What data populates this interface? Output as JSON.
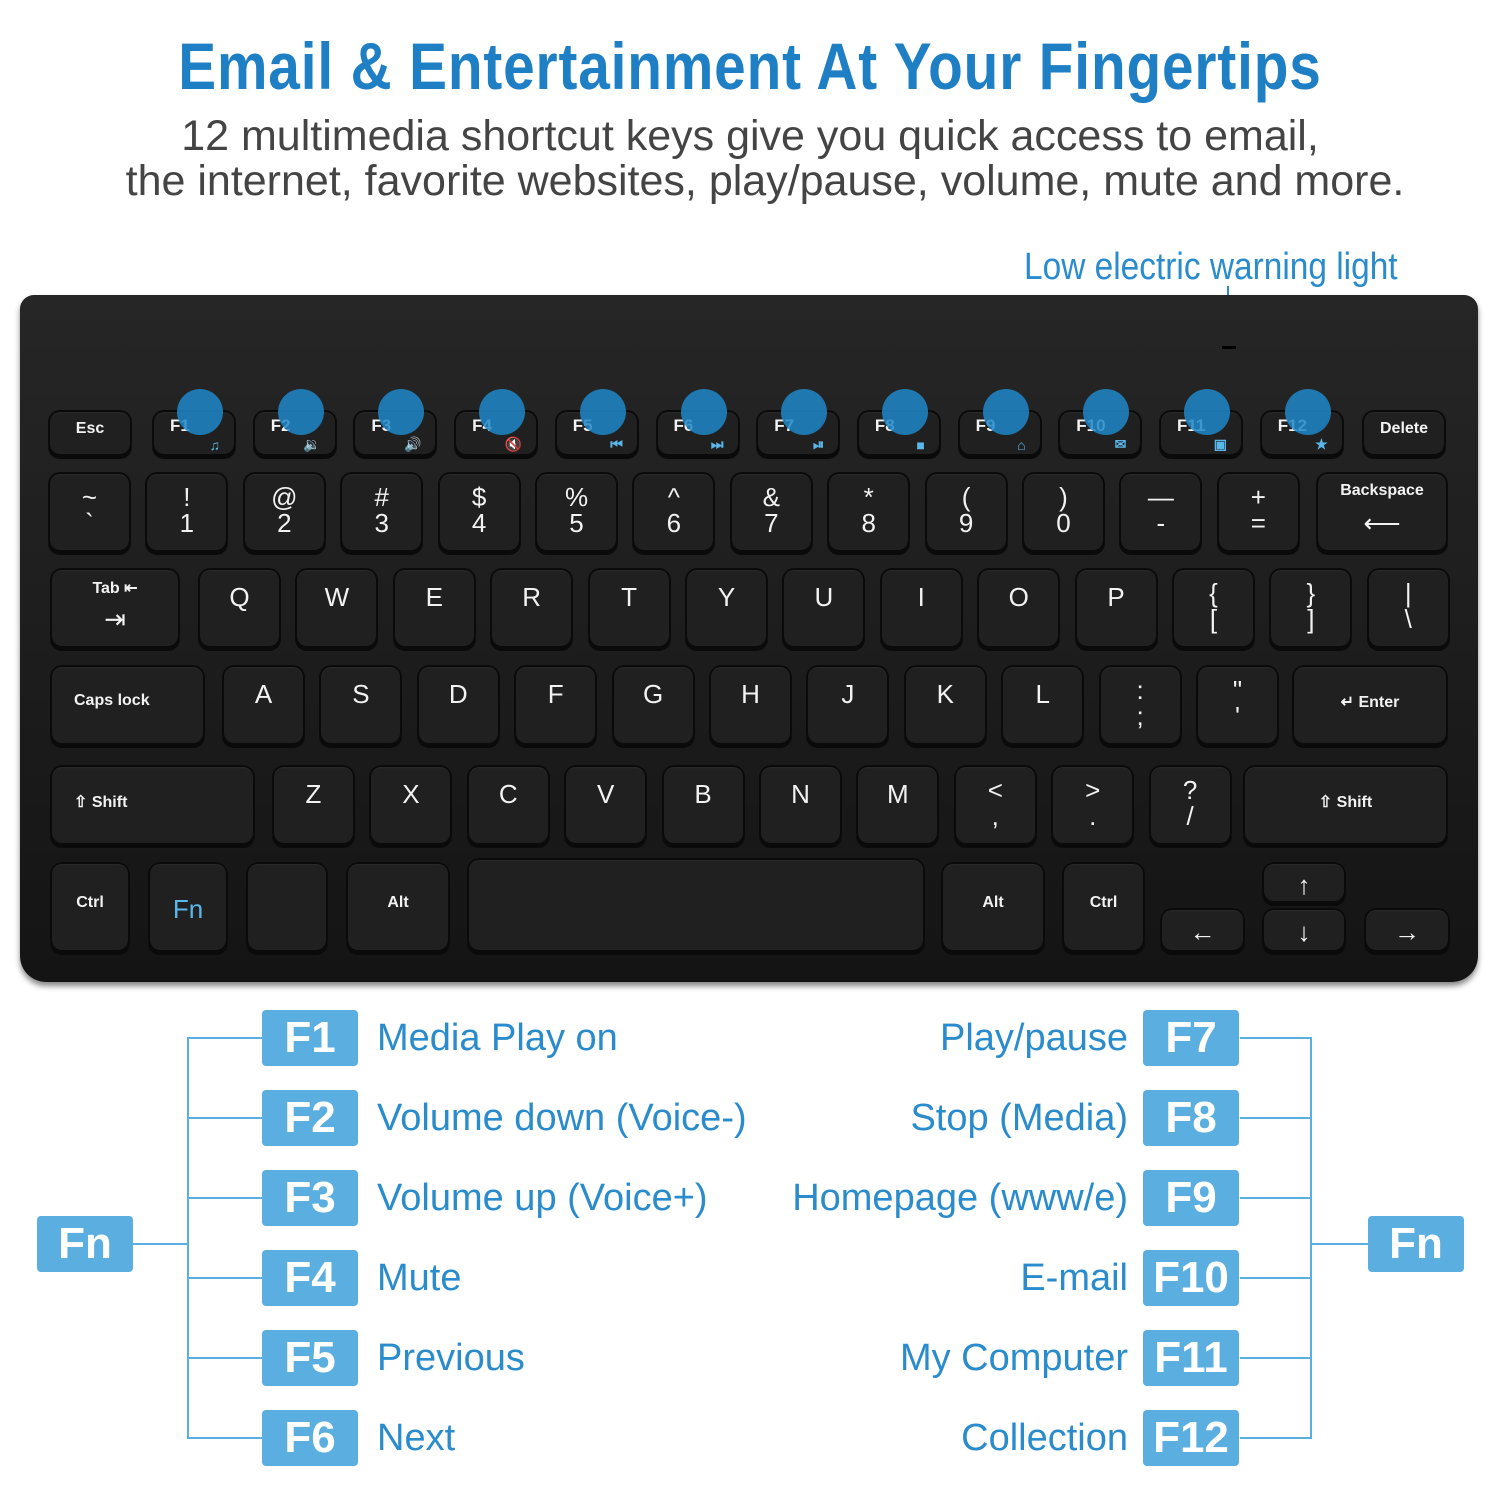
{
  "header": {
    "title": "Email & Entertainment At Your Fingertips",
    "subtitle_line1": "12 multimedia shortcut keys give you quick access to email,",
    "subtitle_line2": "the internet, favorite websites, play/pause, volume, mute and more."
  },
  "warning_light_label": "Low electric warning light",
  "accent_color": "#2a8ccc",
  "keyboard": {
    "function_row": [
      {
        "top": "Esc"
      },
      {
        "top": "F1",
        "icon": "music-note-icon",
        "glyph": "♫"
      },
      {
        "top": "F2",
        "icon": "volume-down-icon",
        "glyph": "🔉"
      },
      {
        "top": "F3",
        "icon": "volume-up-icon",
        "glyph": "🔊"
      },
      {
        "top": "F4",
        "icon": "mute-icon",
        "glyph": "🔇"
      },
      {
        "top": "F5",
        "icon": "previous-track-icon",
        "glyph": "⏮"
      },
      {
        "top": "F6",
        "icon": "next-track-icon",
        "glyph": "⏭"
      },
      {
        "top": "F7",
        "icon": "play-pause-icon",
        "glyph": "⏯"
      },
      {
        "top": "F8",
        "icon": "stop-icon",
        "glyph": "■"
      },
      {
        "top": "F9",
        "icon": "home-icon",
        "glyph": "⌂"
      },
      {
        "top": "F10",
        "icon": "mail-icon",
        "glyph": "✉"
      },
      {
        "top": "F11",
        "icon": "computer-icon",
        "glyph": "▣"
      },
      {
        "top": "F12",
        "icon": "favorites-folder-icon",
        "glyph": "★"
      },
      {
        "top": "Delete"
      }
    ],
    "number_row": [
      {
        "top": "~",
        "bottom": "`"
      },
      {
        "top": "!",
        "bottom": "1"
      },
      {
        "top": "@",
        "bottom": "2"
      },
      {
        "top": "#",
        "bottom": "3"
      },
      {
        "top": "$",
        "bottom": "4"
      },
      {
        "top": "%",
        "bottom": "5"
      },
      {
        "top": "^",
        "bottom": "6"
      },
      {
        "top": "&",
        "bottom": "7"
      },
      {
        "top": "*",
        "bottom": "8"
      },
      {
        "top": "(",
        "bottom": "9"
      },
      {
        "top": ")",
        "bottom": "0"
      },
      {
        "top": "—",
        "bottom": "-"
      },
      {
        "top": "+",
        "bottom": "="
      },
      {
        "top": "Backspace",
        "bottom": "⟵"
      }
    ],
    "qwerty_row": [
      {
        "top": "Tab ⇤",
        "bottom": "⇥"
      },
      {
        "top": "Q"
      },
      {
        "top": "W"
      },
      {
        "top": "E"
      },
      {
        "top": "R"
      },
      {
        "top": "T"
      },
      {
        "top": "Y"
      },
      {
        "top": "U"
      },
      {
        "top": "I"
      },
      {
        "top": "O"
      },
      {
        "top": "P"
      },
      {
        "top": "{",
        "bottom": "["
      },
      {
        "top": "}",
        "bottom": "]"
      },
      {
        "top": "|",
        "bottom": "\\"
      }
    ],
    "home_row": [
      {
        "top": "Caps lock"
      },
      {
        "top": "A"
      },
      {
        "top": "S"
      },
      {
        "top": "D"
      },
      {
        "top": "F"
      },
      {
        "top": "G"
      },
      {
        "top": "H"
      },
      {
        "top": "J"
      },
      {
        "top": "K"
      },
      {
        "top": "L"
      },
      {
        "top": ":",
        "bottom": ";"
      },
      {
        "top": "\"",
        "bottom": "'"
      },
      {
        "top": "↵ Enter"
      }
    ],
    "shift_row": [
      {
        "top": "⇧ Shift"
      },
      {
        "top": "Z"
      },
      {
        "top": "X"
      },
      {
        "top": "C"
      },
      {
        "top": "V"
      },
      {
        "top": "B"
      },
      {
        "top": "N"
      },
      {
        "top": "M"
      },
      {
        "top": "<",
        "bottom": ","
      },
      {
        "top": ">",
        "bottom": "."
      },
      {
        "top": "?",
        "bottom": "/"
      },
      {
        "top": "⇧ Shift"
      }
    ],
    "bottom_row": [
      {
        "top": "Ctrl"
      },
      {
        "top": "Fn"
      },
      {
        "top": ""
      },
      {
        "top": "Alt"
      },
      {
        "top": ""
      },
      {
        "top": "Alt"
      },
      {
        "top": "Ctrl"
      },
      {
        "top": "↑"
      },
      {
        "top": "←"
      },
      {
        "top": "↓"
      },
      {
        "top": "→"
      }
    ]
  },
  "legend": {
    "fn_label": "Fn",
    "left": [
      {
        "key": "F1",
        "label": "Media Play on"
      },
      {
        "key": "F2",
        "label": "Volume down (Voice-)"
      },
      {
        "key": "F3",
        "label": "Volume up (Voice+)"
      },
      {
        "key": "F4",
        "label": "Mute"
      },
      {
        "key": "F5",
        "label": "Previous"
      },
      {
        "key": "F6",
        "label": "Next"
      }
    ],
    "right": [
      {
        "key": "F7",
        "label": "Play/pause"
      },
      {
        "key": "F8",
        "label": "Stop (Media)"
      },
      {
        "key": "F9",
        "label": "Homepage (www/e)"
      },
      {
        "key": "F10",
        "label": "E-mail"
      },
      {
        "key": "F11",
        "label": "My Computer"
      },
      {
        "key": "F12",
        "label": "Collection"
      }
    ]
  }
}
